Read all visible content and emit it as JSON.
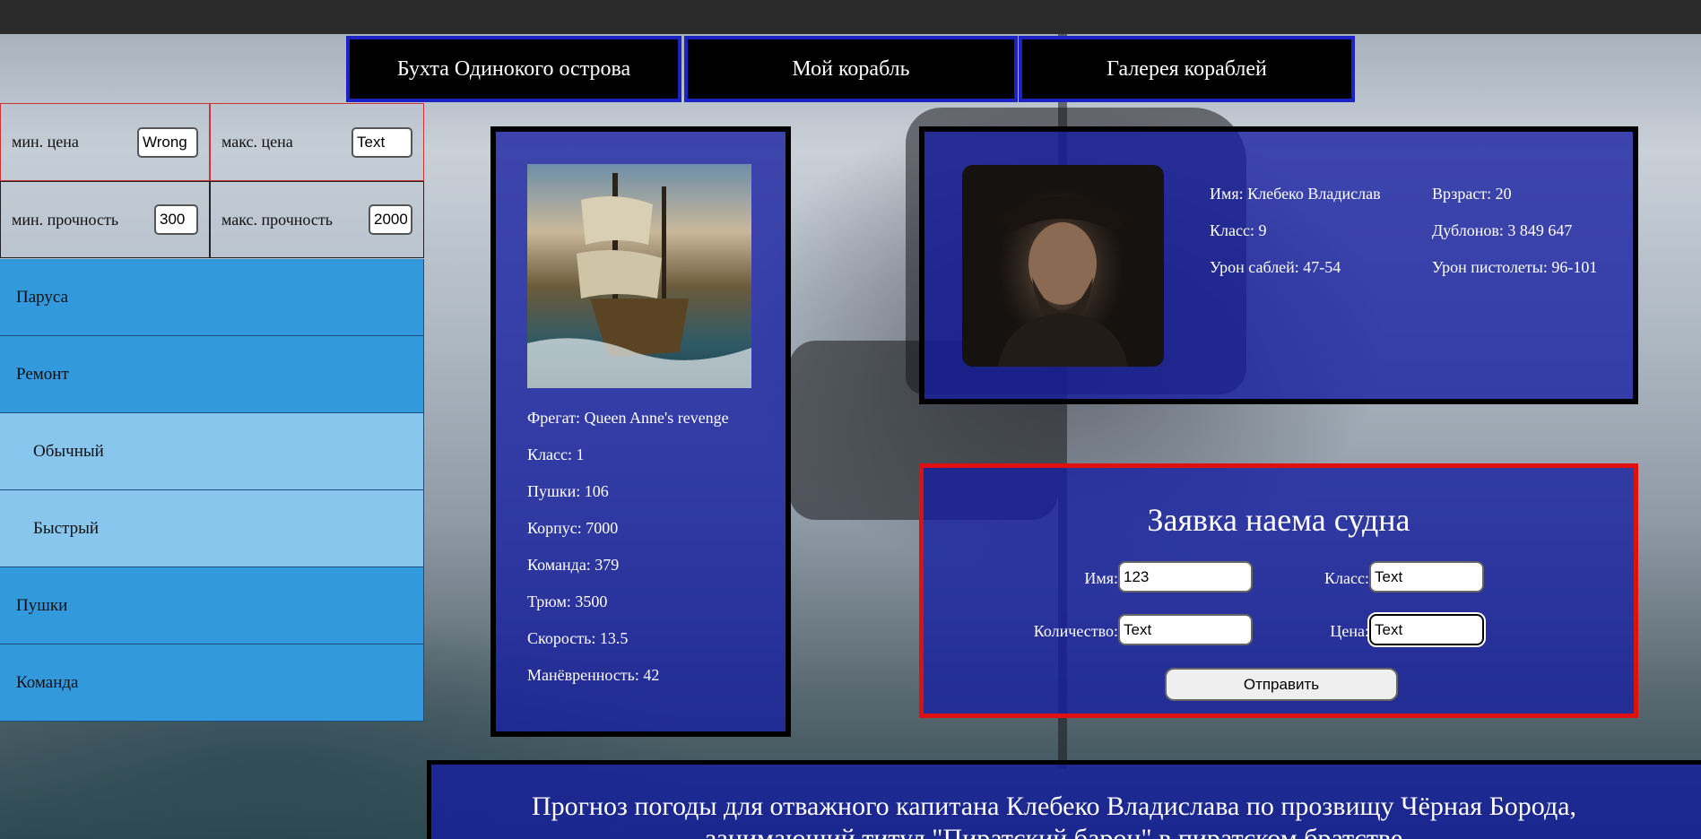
{
  "nav": {
    "items": [
      {
        "label": "Бухта Одинокого острова"
      },
      {
        "label": "Мой корабль"
      },
      {
        "label": "Галерея кораблей"
      }
    ]
  },
  "filters": {
    "min_price": {
      "label": "мин. цена",
      "value": "Wrong"
    },
    "max_price": {
      "label": "макс. цена",
      "value": "Text"
    },
    "min_durability": {
      "label": "мин. прочность",
      "value": "300"
    },
    "max_durability": {
      "label": "макс. прочность",
      "value": "2000"
    }
  },
  "menu": {
    "items": [
      {
        "label": "Паруса"
      },
      {
        "label": "Ремонт"
      },
      {
        "label": "Обычный"
      },
      {
        "label": "Быстрый"
      },
      {
        "label": "Пушки"
      },
      {
        "label": "Команда"
      }
    ]
  },
  "ship": {
    "lines": [
      "Фрегат: Queen Anne's revenge",
      "Класс: 1",
      "Пушки: 106",
      "Корпус: 7000",
      "Команда: 379",
      "Трюм: 3500",
      "Скорость: 13.5",
      "Манёвренность: 42"
    ]
  },
  "captain": {
    "name": "Имя: Клебеко Владислав",
    "age": "Врзраст: 20",
    "class": "Класс: 9",
    "doubloons": "Дублонов: 3 849 647",
    "saber_damage": "Урон саблей: 47-54",
    "pistol_damage": "Урон пистолеты: 96-101"
  },
  "form": {
    "title": "Заявка наема судна",
    "name_label": "Имя:",
    "name_value": "123",
    "class_label": "Класс:",
    "class_value": "Text",
    "quantity_label": "Количество:",
    "quantity_value": "Text",
    "price_label": "Цена:",
    "price_value": "Text",
    "submit_label": "Отправить"
  },
  "weather": {
    "line1": "Прогноз погоды для отважного капитана Клебеко Владислава по прозвищу Чёрная Борода,",
    "line2": "занимающий титул \"Пиратский барон\" в пиратском братстве"
  },
  "colors": {
    "nav_border": "#1c22c4",
    "panel_bg": "#141ea0",
    "menu_main": "#3399dd",
    "menu_sub": "#88c6ee",
    "form_border": "#e01010"
  }
}
